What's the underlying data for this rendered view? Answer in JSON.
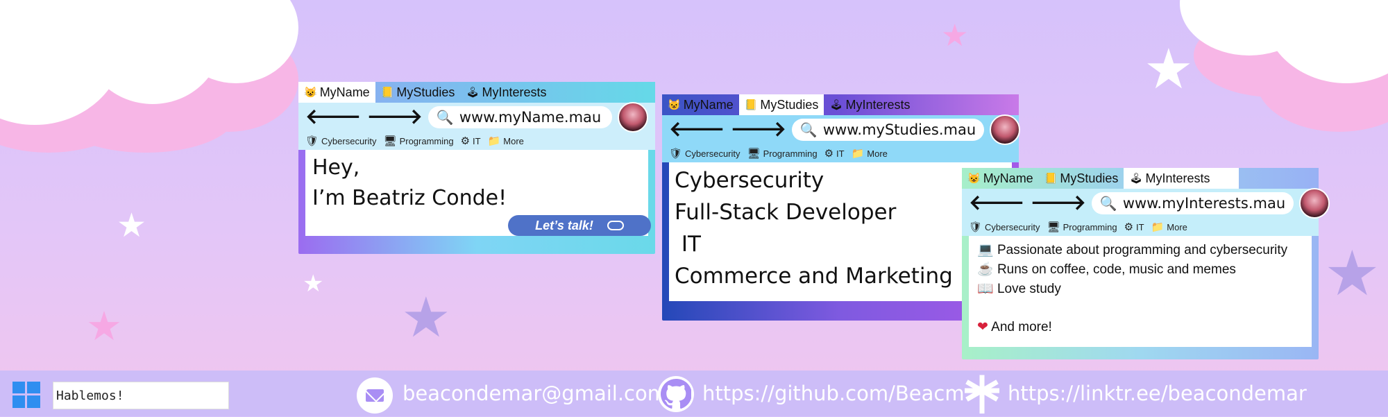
{
  "windows": {
    "name": {
      "tabs": [
        {
          "icon": "😺",
          "label": "MyName"
        },
        {
          "icon": "📒",
          "label": "MyStudies"
        },
        {
          "icon": "🕹",
          "label": "MyInterests"
        }
      ],
      "url": "www.myName.mau",
      "bookmarks": [
        {
          "icon": "🛡",
          "label": "Cybersecurity"
        },
        {
          "icon": "🖥",
          "label": "Programming"
        },
        {
          "icon": "⚙",
          "label": "IT"
        },
        {
          "icon": "📁",
          "label": "More"
        }
      ],
      "lines": [
        "Hey,",
        "I’m Beatriz Conde!"
      ],
      "button": "Let’s talk!"
    },
    "studies": {
      "tabs": [
        {
          "icon": "😺",
          "label": "MyName"
        },
        {
          "icon": "📒",
          "label": "MyStudies"
        },
        {
          "icon": "🕹",
          "label": "MyInterests"
        }
      ],
      "url": "www.myStudies.mau",
      "bookmarks": [
        {
          "icon": "🛡",
          "label": "Cybersecurity"
        },
        {
          "icon": "🖥",
          "label": "Programming"
        },
        {
          "icon": "⚙",
          "label": "IT"
        },
        {
          "icon": "📁",
          "label": "More"
        }
      ],
      "lines": [
        "Cybersecurity",
        "Full-Stack Developer",
        " IT",
        "Commerce and Marketing"
      ]
    },
    "interests": {
      "tabs": [
        {
          "icon": "😺",
          "label": "MyName"
        },
        {
          "icon": "📒",
          "label": "MyStudies"
        },
        {
          "icon": "🕹",
          "label": "MyInterests"
        }
      ],
      "url": "www.myInterests.mau",
      "bookmarks": [
        {
          "icon": "🛡",
          "label": "Cybersecurity"
        },
        {
          "icon": "🖥",
          "label": "Programming"
        },
        {
          "icon": "⚙",
          "label": "IT"
        },
        {
          "icon": "📁",
          "label": "More"
        }
      ],
      "lines": [
        {
          "icon": "💻",
          "text": "Passionate about programming and cybersecurity"
        },
        {
          "icon": "☕",
          "text": "Runs on coffee, code, music and memes"
        },
        {
          "icon": "📖",
          "text": "Love study"
        },
        {
          "icon": "",
          "text": ""
        },
        {
          "icon": "❤",
          "text": "And more!"
        }
      ]
    }
  },
  "taskbar": {
    "search_value": "Hablemos!",
    "email": "beacondemar@gmail.com",
    "github": "https://github.com/Beacm",
    "linktree": "https://linktr.ee/beacondemar"
  },
  "icons": {
    "start": "windows-icon",
    "email": "mail-icon",
    "github": "github-icon",
    "linktree": "linktree-icon"
  },
  "colors": {
    "background": "#d6c2fb",
    "taskbar": "#cdbdf8",
    "button": "#4f72c8",
    "link_text": "#ffffff"
  }
}
